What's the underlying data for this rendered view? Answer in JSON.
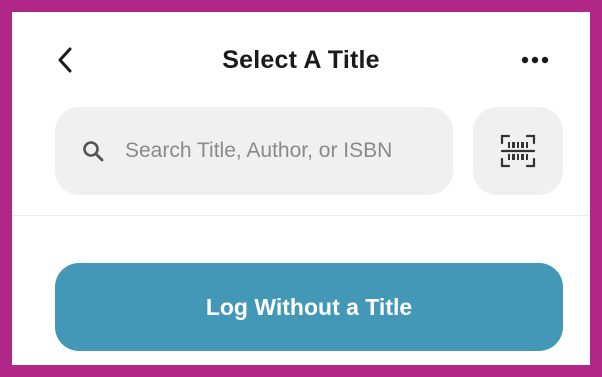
{
  "header": {
    "title": "Select A Title",
    "back_icon": "chevron-left-icon",
    "more_icon": "more-horizontal-icon"
  },
  "search": {
    "placeholder": "Search Title, Author, or ISBN",
    "value": "",
    "icon": "search-icon"
  },
  "scan": {
    "icon": "barcode-scan-icon"
  },
  "log_button": {
    "label": "Log Without a Title"
  },
  "colors": {
    "frame_border": "#b02788",
    "primary_button": "#4298b6",
    "field_background": "#f0f0f0",
    "title_text": "#1a1a1a",
    "placeholder_text": "#8a8a8a"
  }
}
